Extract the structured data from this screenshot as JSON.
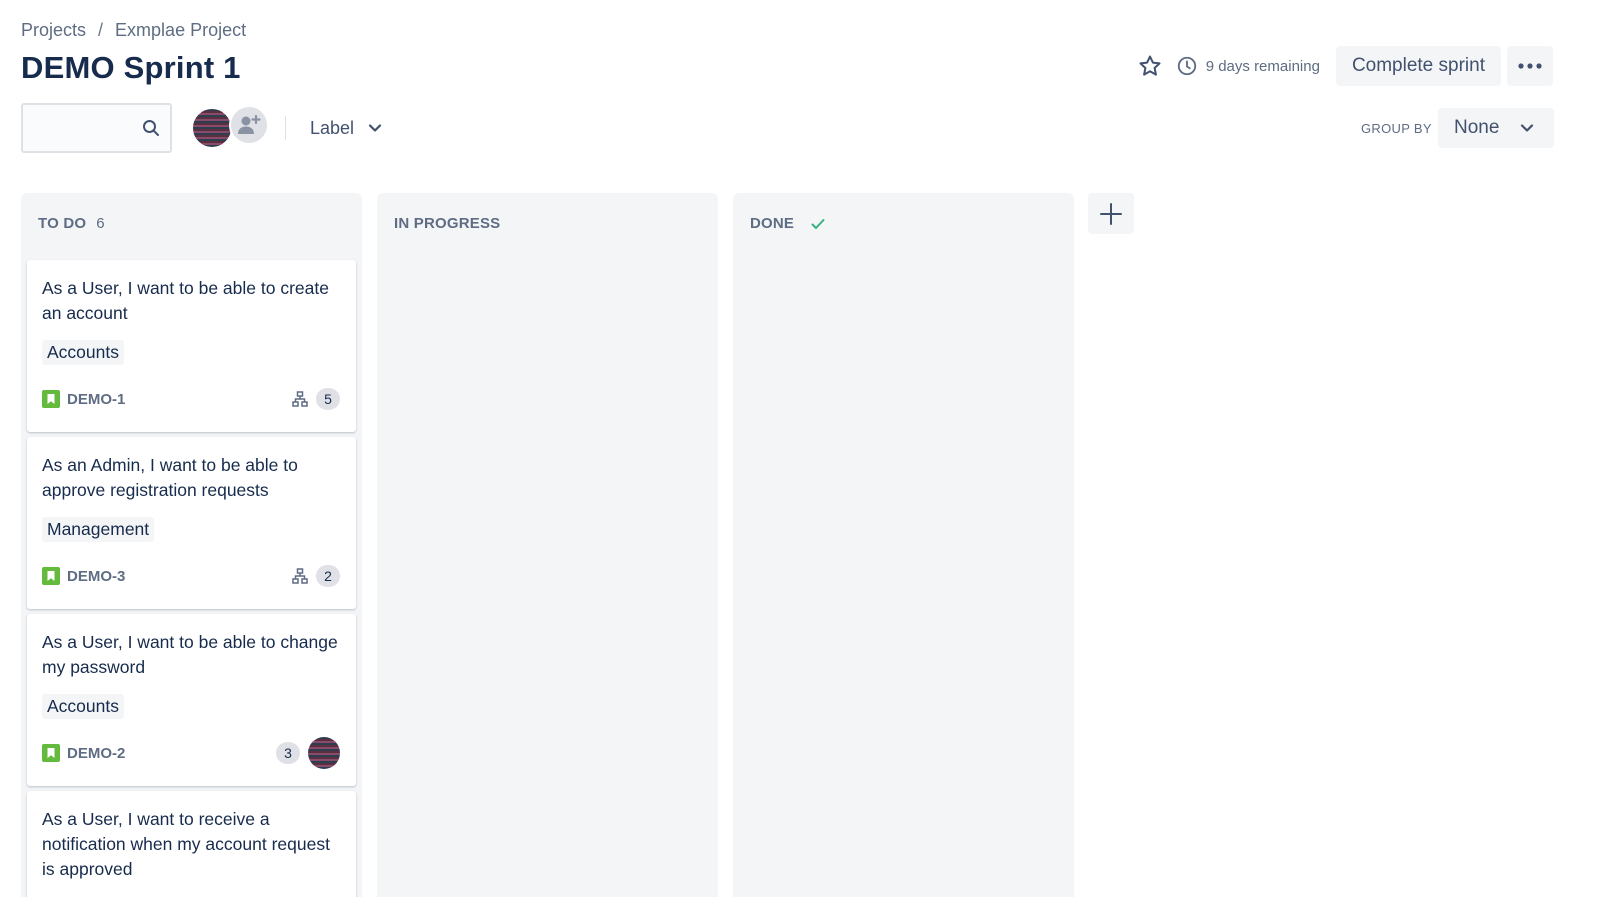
{
  "breadcrumb": {
    "projects": "Projects",
    "separator": "/",
    "project": "Exmplae Project"
  },
  "title": "DEMO Sprint 1",
  "header": {
    "remaining": "9 days remaining",
    "complete_label": "Complete sprint",
    "star_icon": "star-icon",
    "clock_icon": "clock-icon",
    "more_icon": "more-icon"
  },
  "filters": {
    "search_value": "",
    "label_filter": "Label",
    "group_by_label": "GROUP BY",
    "group_by_value": "None"
  },
  "columns": [
    {
      "title": "TO DO",
      "count": "6"
    },
    {
      "title": "IN PROGRESS"
    },
    {
      "title": "DONE"
    }
  ],
  "cards": [
    {
      "summary": "As a User, I want to be able to create an account",
      "label": "Accounts",
      "key": "DEMO-1",
      "subtasks": "5"
    },
    {
      "summary": "As an Admin, I want to be able to approve registration requests",
      "label": "Management",
      "key": "DEMO-3",
      "subtasks": "2"
    },
    {
      "summary": "As a User, I want to be able to change my password",
      "label": "Accounts",
      "key": "DEMO-2",
      "estimate": "3"
    },
    {
      "summary": "As a User, I want to receive a notification when my account request is approved"
    }
  ],
  "colors": {
    "text_primary": "#172b4d",
    "text_secondary": "#5e6c84",
    "column_bg": "#f4f5f7",
    "story_green": "#63ba3c",
    "done_check": "#36b37e"
  }
}
